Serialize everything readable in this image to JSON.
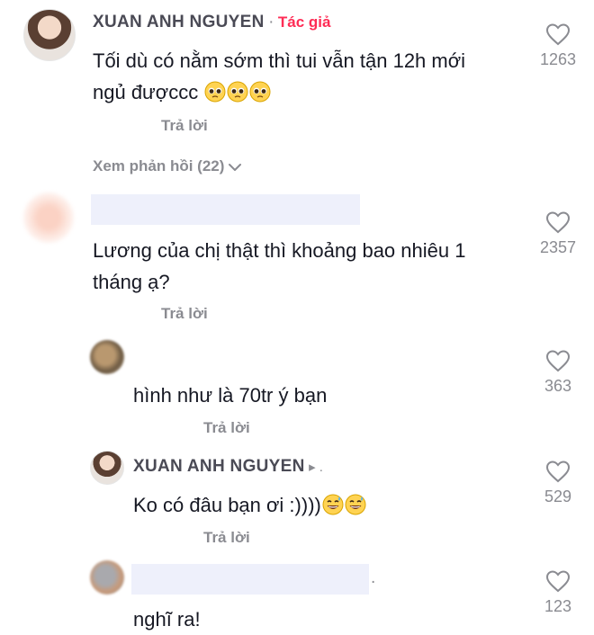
{
  "comments": [
    {
      "author": "XUAN ANH NGUYEN",
      "separator": "·",
      "author_tag": "Tác giả",
      "text_line1": "Tối dù có nằm sớm thì tui vẫn tận 12h mới",
      "text_line2": "ngủ đượccc",
      "emojis": [
        "pleading-face",
        "pleading-face",
        "pleading-face"
      ],
      "likes": "1263",
      "reply_label": "Trả lời",
      "view_replies": "Xem phản hồi (22)"
    },
    {
      "author": "",
      "text_line1": "Lương của chị thật thì khoảng bao nhiêu 1",
      "text_line2": "tháng ạ?",
      "likes": "2357",
      "reply_label": "Trả lời"
    }
  ],
  "replies": [
    {
      "author": "",
      "text": "hình như là 70tr ý bạn",
      "likes": "363",
      "reply_label": "Trả lời"
    },
    {
      "author": "XUAN ANH NGUYEN",
      "suffix": "▸ .",
      "text": "Ko có đâu bạn ơi :))))",
      "emojis": [
        "grinning-sweat-face",
        "grinning-sweat-face"
      ],
      "likes": "529",
      "reply_label": "Trả lời"
    },
    {
      "author": "",
      "suffix": ".",
      "text": "nghĩ ra!",
      "likes": "123"
    }
  ],
  "colors": {
    "author_tag": "#fe2c55",
    "muted": "#8a8b91",
    "text": "#161823"
  }
}
